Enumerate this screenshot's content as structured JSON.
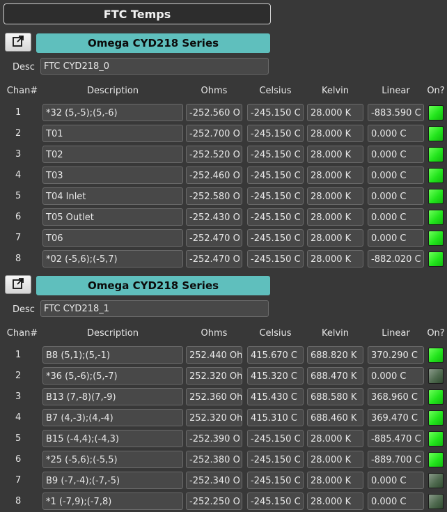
{
  "title": "FTC Temps",
  "icons": {
    "popout": "popout-window-icon"
  },
  "colors": {
    "banner": "#5fbfbd",
    "led_on": "#22e51c",
    "led_off": "#4f6a4f"
  },
  "headers": {
    "chan": "Chan#",
    "description": "Description",
    "ohms": "Ohms",
    "celsius": "Celsius",
    "kelvin": "Kelvin",
    "linear": "Linear",
    "on": "On?"
  },
  "sections": [
    {
      "series": "Omega CYD218 Series",
      "desc_label": "Desc",
      "desc_value": "FTC CYD218_0",
      "rows": [
        {
          "chan": "1",
          "description": "*32 (5,-5);(5,-6)",
          "ohms": "-252.560 O",
          "celsius": "-245.150 C",
          "kelvin": "28.000 K",
          "linear": "-883.590 C",
          "on": true
        },
        {
          "chan": "2",
          "description": "T01",
          "ohms": "-252.700 O",
          "celsius": "-245.150 C",
          "kelvin": "28.000 K",
          "linear": "0.000 C",
          "on": true
        },
        {
          "chan": "3",
          "description": "T02",
          "ohms": "-252.520 O",
          "celsius": "-245.150 C",
          "kelvin": "28.000 K",
          "linear": "0.000 C",
          "on": true
        },
        {
          "chan": "4",
          "description": "T03",
          "ohms": "-252.460 O",
          "celsius": "-245.150 C",
          "kelvin": "28.000 K",
          "linear": "0.000 C",
          "on": true
        },
        {
          "chan": "5",
          "description": "T04 Inlet",
          "ohms": "-252.580 O",
          "celsius": "-245.150 C",
          "kelvin": "28.000 K",
          "linear": "0.000 C",
          "on": true
        },
        {
          "chan": "6",
          "description": "T05 Outlet",
          "ohms": "-252.430 O",
          "celsius": "-245.150 C",
          "kelvin": "28.000 K",
          "linear": "0.000 C",
          "on": true
        },
        {
          "chan": "7",
          "description": "T06",
          "ohms": "-252.470 O",
          "celsius": "-245.150 C",
          "kelvin": "28.000 K",
          "linear": "0.000 C",
          "on": true
        },
        {
          "chan": "8",
          "description": "*02 (-5,6);(-5,7)",
          "ohms": "-252.470 O",
          "celsius": "-245.150 C",
          "kelvin": "28.000 K",
          "linear": "-882.020 C",
          "on": true
        }
      ]
    },
    {
      "series": "Omega CYD218 Series",
      "desc_label": "Desc",
      "desc_value": "FTC CYD218_1",
      "rows": [
        {
          "chan": "1",
          "description": "B8 (5,1);(5,-1)",
          "ohms": "252.440 Oh",
          "celsius": "415.670 C",
          "kelvin": "688.820 K",
          "linear": "370.290 C",
          "on": true
        },
        {
          "chan": "2",
          "description": "*36 (5,-6);(5,-7)",
          "ohms": "252.320 Oh",
          "celsius": "415.320 C",
          "kelvin": "688.470 K",
          "linear": "0.000 C",
          "on": false
        },
        {
          "chan": "3",
          "description": "B13 (7,-8)(7,-9)",
          "ohms": "252.360 Oh",
          "celsius": "415.430 C",
          "kelvin": "688.580 K",
          "linear": "368.960 C",
          "on": true
        },
        {
          "chan": "4",
          "description": "B7 (4,-3);(4,-4)",
          "ohms": "252.320 Oh",
          "celsius": "415.310 C",
          "kelvin": "688.460 K",
          "linear": "369.470 C",
          "on": true
        },
        {
          "chan": "5",
          "description": "B15 (-4,4);(-4,3)",
          "ohms": "-252.390 O",
          "celsius": "-245.150 C",
          "kelvin": "28.000 K",
          "linear": "-885.470 C",
          "on": true
        },
        {
          "chan": "6",
          "description": "*25 (-5,6);(-5,5)",
          "ohms": "-252.380 O",
          "celsius": "-245.150 C",
          "kelvin": "28.000 K",
          "linear": "-889.700 C",
          "on": true
        },
        {
          "chan": "7",
          "description": "B9 (-7,-4);(-7,-5)",
          "ohms": "-252.340 O",
          "celsius": "-245.150 C",
          "kelvin": "28.000 K",
          "linear": "0.000 C",
          "on": false
        },
        {
          "chan": "8",
          "description": "*1 (-7,9);(-7,8)",
          "ohms": "-252.250 O",
          "celsius": "-245.150 C",
          "kelvin": "28.000 K",
          "linear": "0.000 C",
          "on": false
        }
      ]
    }
  ]
}
